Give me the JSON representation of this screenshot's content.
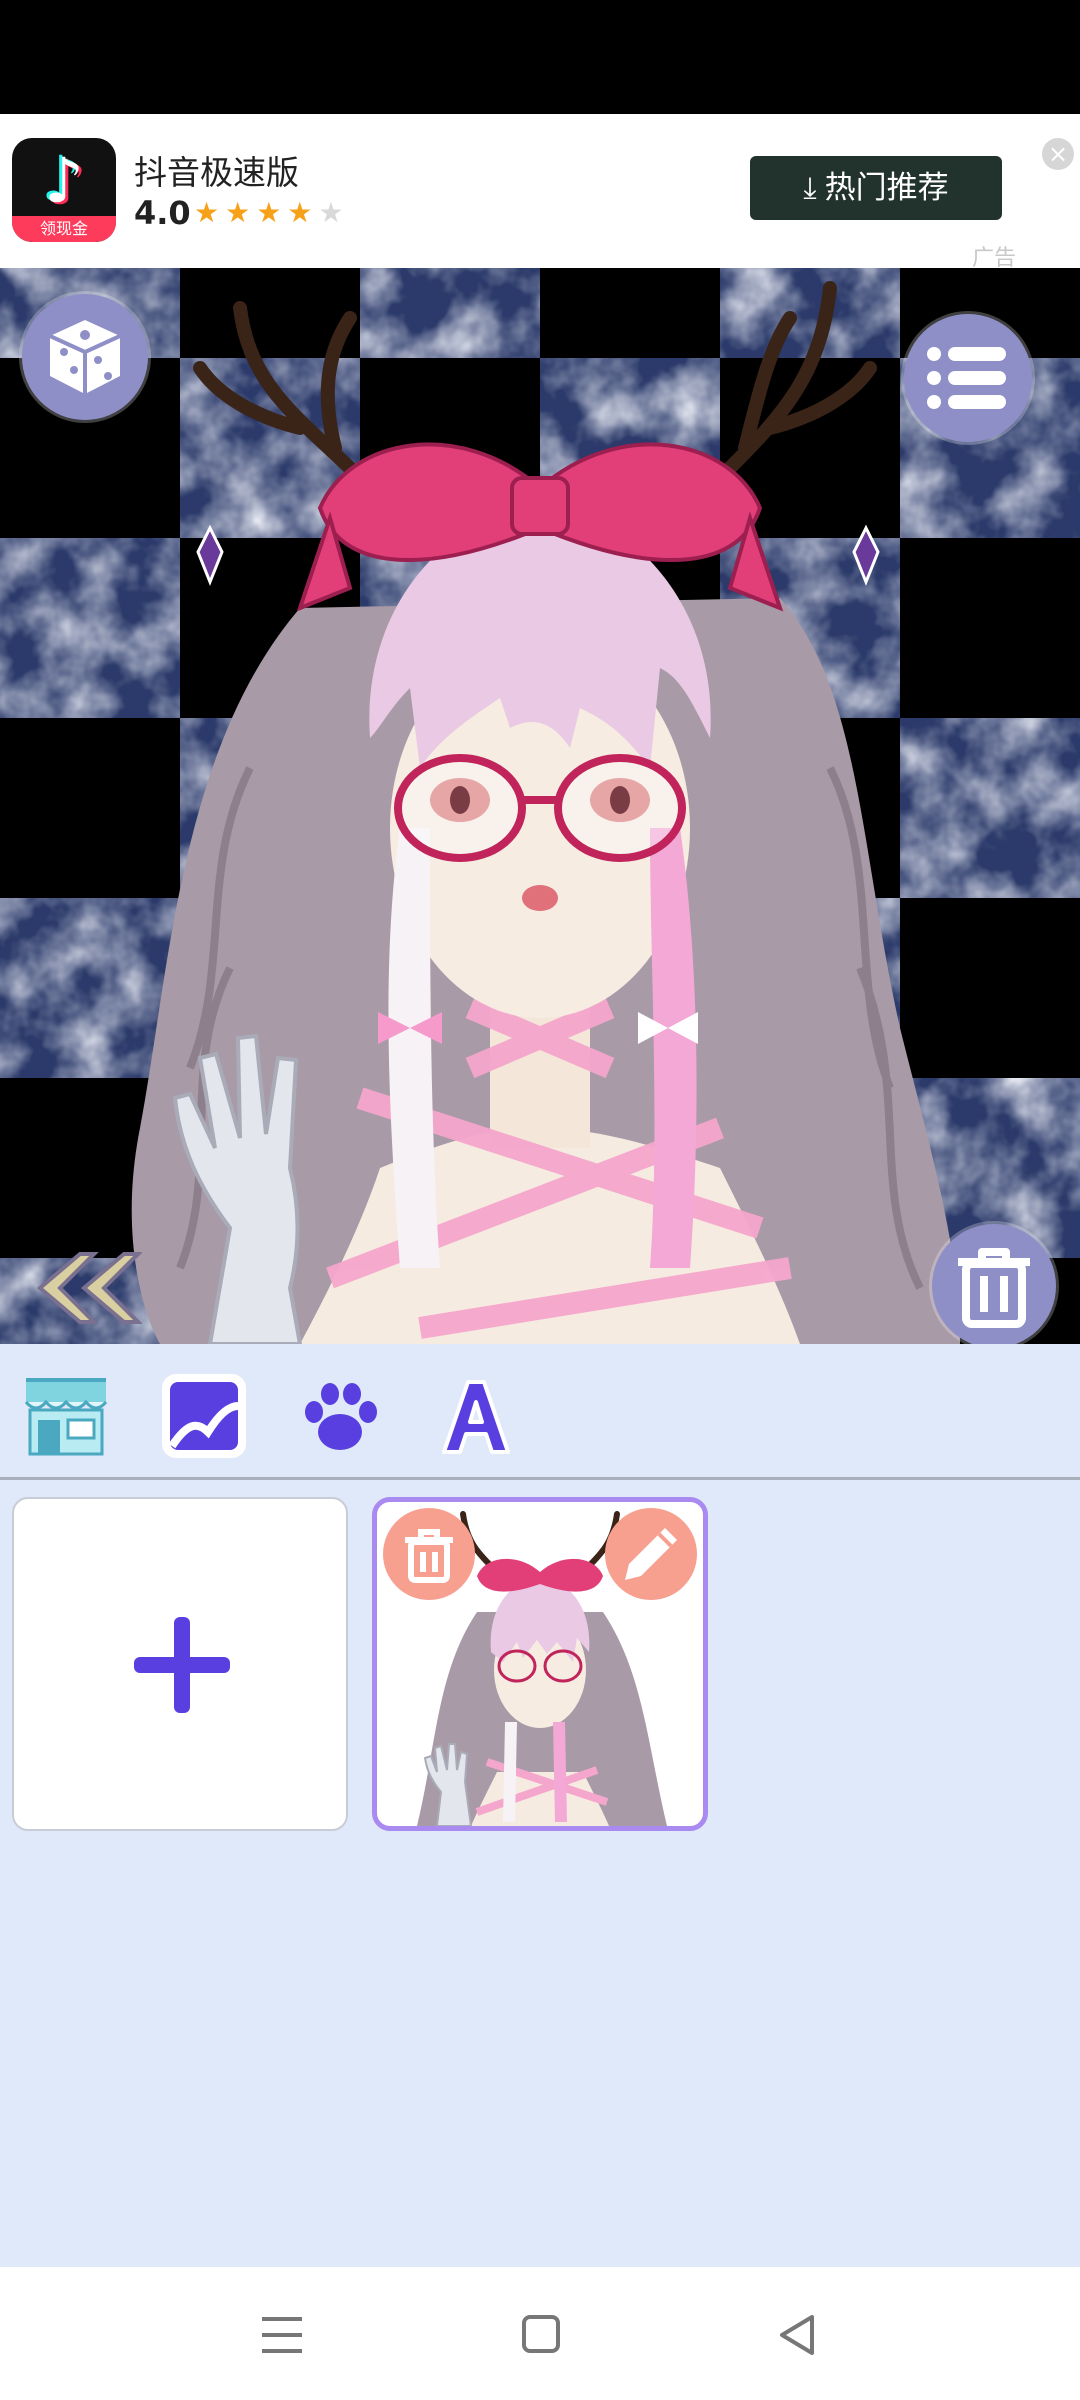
{
  "ad": {
    "app_name": "抖音极速版",
    "rating": "4.0",
    "stars_on": "★★★★",
    "stars_off": "★",
    "icon_ribbon": "领现金",
    "cta_label": "热门推荐",
    "ad_label": "广告",
    "close_glyph": "×"
  },
  "canvas": {
    "buttons": [
      "dice-icon",
      "list-menu-icon",
      "trash-icon",
      "double-chevron-left-icon"
    ]
  },
  "toolbar": {
    "items": [
      "shop-icon",
      "background-icon",
      "paw-icon",
      "text-a-icon"
    ]
  },
  "gallery": {
    "new_label": "+",
    "saved": [
      {
        "actions": [
          "trash-icon",
          "pencil-icon"
        ]
      }
    ]
  },
  "colors": {
    "accent": "#5a3fe0",
    "button_bg": "#8f8fc8",
    "gallery_bg": "#dfe9f9",
    "card_border": "#a98af0",
    "card_action": "#f7a090",
    "ad_button": "#22332e"
  }
}
